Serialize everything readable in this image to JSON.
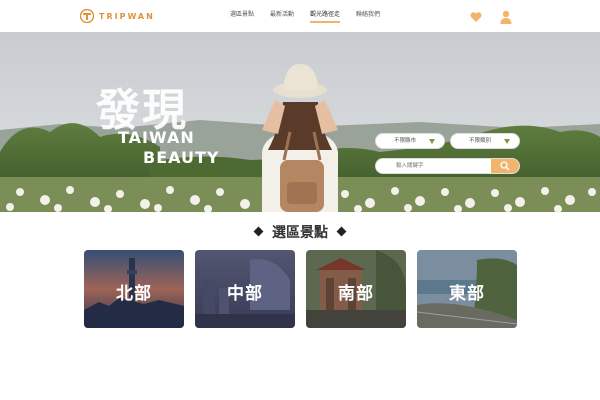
{
  "brand": {
    "name": "TRIPWAN",
    "accent": "#f2b36d",
    "logo_color": "#e0913a"
  },
  "nav": {
    "items": [
      {
        "label": "選區景點",
        "active": false
      },
      {
        "label": "最新活動",
        "active": false
      },
      {
        "label": "觀光路徑走",
        "active": true
      },
      {
        "label": "聯絡我們",
        "active": false
      }
    ]
  },
  "header_icons": {
    "favorites": "heart-icon",
    "account": "user-icon"
  },
  "hero": {
    "title": "發現",
    "subtitle_line1": "TAIWAN",
    "subtitle_line2": "BEAUTY"
  },
  "filters": {
    "city": "不限縣市",
    "category": "不限類別"
  },
  "search": {
    "placeholder": "輸入關鍵字"
  },
  "regions": {
    "heading": "選區景點",
    "items": [
      {
        "label": "北部"
      },
      {
        "label": "中部"
      },
      {
        "label": "南部"
      },
      {
        "label": "東部"
      }
    ]
  }
}
